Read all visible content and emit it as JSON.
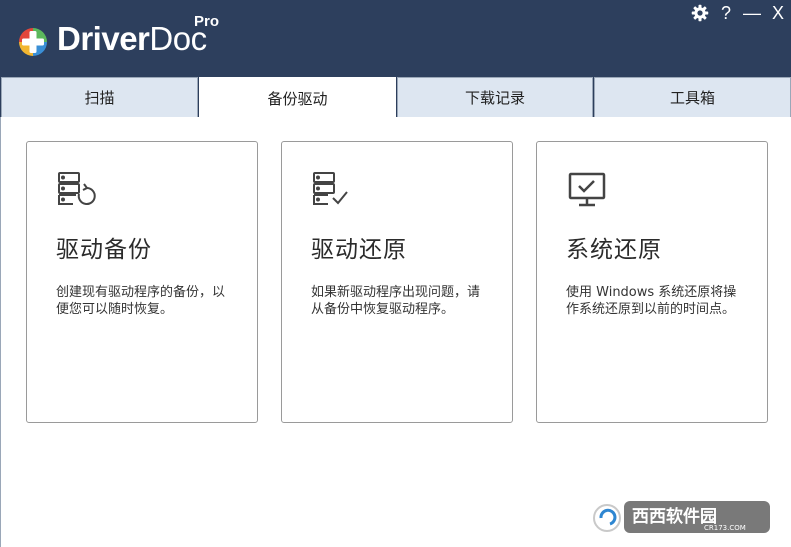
{
  "app": {
    "brand_bold": "Driver",
    "brand_regular": "Doc",
    "edition": "Pro"
  },
  "window_controls": {
    "settings_icon": "gear-icon",
    "help": "?",
    "minimize": "—",
    "close": "X"
  },
  "tabs": [
    {
      "label": "扫描",
      "active": false
    },
    {
      "label": "备份驱动",
      "active": true
    },
    {
      "label": "下载记录",
      "active": false
    },
    {
      "label": "工具箱",
      "active": false
    }
  ],
  "cards": [
    {
      "icon": "server-restore-icon",
      "title": "驱动备份",
      "desc": "创建现有驱动程序的备份，以便您可以随时恢复。"
    },
    {
      "icon": "server-check-icon",
      "title": "驱动还原",
      "desc": "如果新驱动程序出现问题，请从备份中恢复驱动程序。"
    },
    {
      "icon": "monitor-check-icon",
      "title": "系统还原",
      "desc": "使用 Windows 系统还原将操作系统还原到以前的时间点。"
    }
  ],
  "watermark": {
    "text": "西西软件园",
    "sub": "CR173.COM"
  },
  "colors": {
    "titlebar": "#2d3f5d",
    "tab_inactive": "#dde6f1",
    "logo_red": "#e2463b",
    "logo_green": "#5cb85c",
    "logo_yellow": "#f2b630",
    "logo_blue": "#3a8fd6"
  }
}
